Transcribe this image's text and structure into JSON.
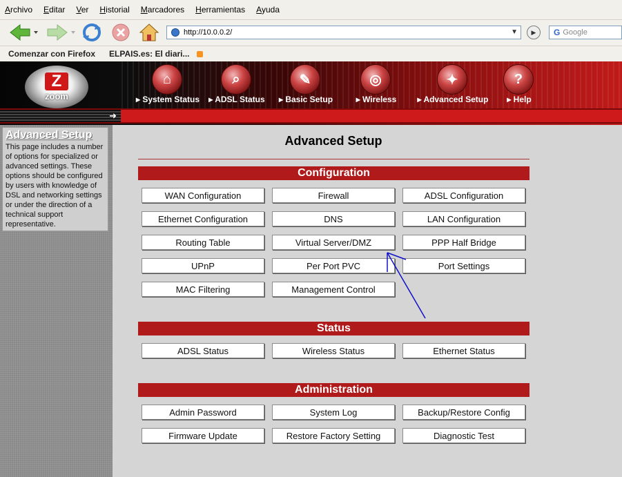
{
  "browser": {
    "menu": [
      "Archivo",
      "Editar",
      "Ver",
      "Historial",
      "Marcadores",
      "Herramientas",
      "Ayuda"
    ],
    "url": "http://10.0.0.2/",
    "search_placeholder": "Google",
    "bookmarks": [
      "Comenzar con Firefox",
      "ELPAIS.es: El diari..."
    ]
  },
  "router": {
    "logo_text": "zoom",
    "nav": [
      {
        "label": "System Status",
        "icon": "system-status-icon"
      },
      {
        "label": "ADSL Status",
        "icon": "adsl-status-icon"
      },
      {
        "label": "Basic Setup",
        "icon": "basic-setup-icon"
      },
      {
        "label": "Wireless",
        "icon": "wireless-icon"
      },
      {
        "label": "Advanced Setup",
        "icon": "advanced-setup-icon"
      },
      {
        "label": "Help",
        "icon": "help-icon"
      }
    ]
  },
  "sidebar": {
    "title": "Advanced Setup",
    "description": "This page includes a number of options for specialized or advanced settings. These options should be configured by users with knowledge of DSL and networking settings or under the direction of a technical support representative."
  },
  "page": {
    "title": "Advanced Setup",
    "sections": [
      {
        "title": "Configuration",
        "buttons": [
          "WAN Configuration",
          "Firewall",
          "ADSL Configuration",
          "Ethernet Configuration",
          "DNS",
          "LAN Configuration",
          "Routing Table",
          "Virtual Server/DMZ",
          "PPP Half Bridge",
          "UPnP",
          "Per Port PVC",
          "Port Settings",
          "MAC Filtering",
          "Management Control"
        ]
      },
      {
        "title": "Status",
        "buttons": [
          "ADSL Status",
          "Wireless Status",
          "Ethernet Status"
        ]
      },
      {
        "title": "Administration",
        "buttons": [
          "Admin Password",
          "System Log",
          "Backup/Restore Config",
          "Firmware Update",
          "Restore Factory Setting",
          "Diagnostic Test"
        ]
      }
    ]
  },
  "annotation_color": "#1010c8"
}
